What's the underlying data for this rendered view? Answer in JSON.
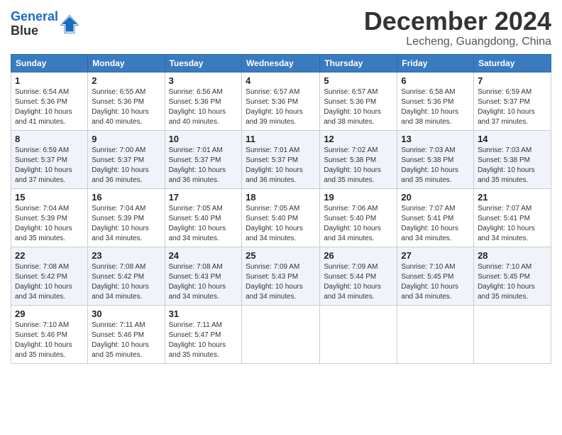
{
  "logo": {
    "line1": "General",
    "line2": "Blue"
  },
  "header": {
    "month": "December 2024",
    "location": "Lecheng, Guangdong, China"
  },
  "weekdays": [
    "Sunday",
    "Monday",
    "Tuesday",
    "Wednesday",
    "Thursday",
    "Friday",
    "Saturday"
  ],
  "weeks": [
    [
      {
        "day": "1",
        "sunrise": "6:54 AM",
        "sunset": "5:36 PM",
        "daylight": "10 hours and 41 minutes."
      },
      {
        "day": "2",
        "sunrise": "6:55 AM",
        "sunset": "5:36 PM",
        "daylight": "10 hours and 40 minutes."
      },
      {
        "day": "3",
        "sunrise": "6:56 AM",
        "sunset": "5:36 PM",
        "daylight": "10 hours and 40 minutes."
      },
      {
        "day": "4",
        "sunrise": "6:57 AM",
        "sunset": "5:36 PM",
        "daylight": "10 hours and 39 minutes."
      },
      {
        "day": "5",
        "sunrise": "6:57 AM",
        "sunset": "5:36 PM",
        "daylight": "10 hours and 38 minutes."
      },
      {
        "day": "6",
        "sunrise": "6:58 AM",
        "sunset": "5:36 PM",
        "daylight": "10 hours and 38 minutes."
      },
      {
        "day": "7",
        "sunrise": "6:59 AM",
        "sunset": "5:37 PM",
        "daylight": "10 hours and 37 minutes."
      }
    ],
    [
      {
        "day": "8",
        "sunrise": "6:59 AM",
        "sunset": "5:37 PM",
        "daylight": "10 hours and 37 minutes."
      },
      {
        "day": "9",
        "sunrise": "7:00 AM",
        "sunset": "5:37 PM",
        "daylight": "10 hours and 36 minutes."
      },
      {
        "day": "10",
        "sunrise": "7:01 AM",
        "sunset": "5:37 PM",
        "daylight": "10 hours and 36 minutes."
      },
      {
        "day": "11",
        "sunrise": "7:01 AM",
        "sunset": "5:37 PM",
        "daylight": "10 hours and 36 minutes."
      },
      {
        "day": "12",
        "sunrise": "7:02 AM",
        "sunset": "5:38 PM",
        "daylight": "10 hours and 35 minutes."
      },
      {
        "day": "13",
        "sunrise": "7:03 AM",
        "sunset": "5:38 PM",
        "daylight": "10 hours and 35 minutes."
      },
      {
        "day": "14",
        "sunrise": "7:03 AM",
        "sunset": "5:38 PM",
        "daylight": "10 hours and 35 minutes."
      }
    ],
    [
      {
        "day": "15",
        "sunrise": "7:04 AM",
        "sunset": "5:39 PM",
        "daylight": "10 hours and 35 minutes."
      },
      {
        "day": "16",
        "sunrise": "7:04 AM",
        "sunset": "5:39 PM",
        "daylight": "10 hours and 34 minutes."
      },
      {
        "day": "17",
        "sunrise": "7:05 AM",
        "sunset": "5:40 PM",
        "daylight": "10 hours and 34 minutes."
      },
      {
        "day": "18",
        "sunrise": "7:05 AM",
        "sunset": "5:40 PM",
        "daylight": "10 hours and 34 minutes."
      },
      {
        "day": "19",
        "sunrise": "7:06 AM",
        "sunset": "5:40 PM",
        "daylight": "10 hours and 34 minutes."
      },
      {
        "day": "20",
        "sunrise": "7:07 AM",
        "sunset": "5:41 PM",
        "daylight": "10 hours and 34 minutes."
      },
      {
        "day": "21",
        "sunrise": "7:07 AM",
        "sunset": "5:41 PM",
        "daylight": "10 hours and 34 minutes."
      }
    ],
    [
      {
        "day": "22",
        "sunrise": "7:08 AM",
        "sunset": "5:42 PM",
        "daylight": "10 hours and 34 minutes."
      },
      {
        "day": "23",
        "sunrise": "7:08 AM",
        "sunset": "5:42 PM",
        "daylight": "10 hours and 34 minutes."
      },
      {
        "day": "24",
        "sunrise": "7:08 AM",
        "sunset": "5:43 PM",
        "daylight": "10 hours and 34 minutes."
      },
      {
        "day": "25",
        "sunrise": "7:09 AM",
        "sunset": "5:43 PM",
        "daylight": "10 hours and 34 minutes."
      },
      {
        "day": "26",
        "sunrise": "7:09 AM",
        "sunset": "5:44 PM",
        "daylight": "10 hours and 34 minutes."
      },
      {
        "day": "27",
        "sunrise": "7:10 AM",
        "sunset": "5:45 PM",
        "daylight": "10 hours and 34 minutes."
      },
      {
        "day": "28",
        "sunrise": "7:10 AM",
        "sunset": "5:45 PM",
        "daylight": "10 hours and 35 minutes."
      }
    ],
    [
      {
        "day": "29",
        "sunrise": "7:10 AM",
        "sunset": "5:46 PM",
        "daylight": "10 hours and 35 minutes."
      },
      {
        "day": "30",
        "sunrise": "7:11 AM",
        "sunset": "5:46 PM",
        "daylight": "10 hours and 35 minutes."
      },
      {
        "day": "31",
        "sunrise": "7:11 AM",
        "sunset": "5:47 PM",
        "daylight": "10 hours and 35 minutes."
      },
      null,
      null,
      null,
      null
    ]
  ]
}
